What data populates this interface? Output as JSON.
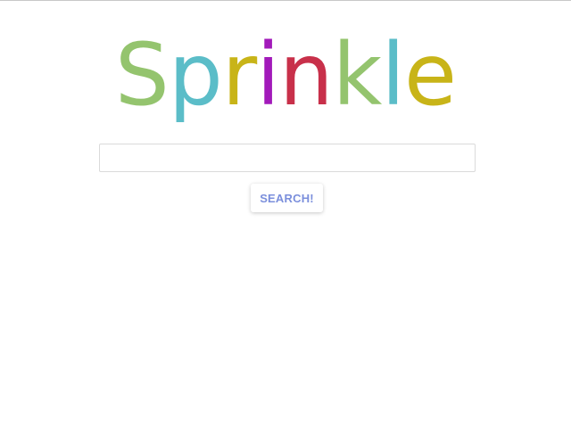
{
  "logo": {
    "letters": [
      {
        "char": "S",
        "color": "#94c46e"
      },
      {
        "char": "p",
        "color": "#5bbdc8"
      },
      {
        "char": "r",
        "color": "#c8b418"
      },
      {
        "char": "i",
        "color": "#a21aba"
      },
      {
        "char": "n",
        "color": "#c8304a"
      },
      {
        "char": "k",
        "color": "#94c46e"
      },
      {
        "char": "l",
        "color": "#5bbdc8"
      },
      {
        "char": "e",
        "color": "#c8b418"
      }
    ]
  },
  "search": {
    "value": "",
    "placeholder": ""
  },
  "search_button": {
    "label": "SEARCH!",
    "color": "#7b8fdc"
  }
}
